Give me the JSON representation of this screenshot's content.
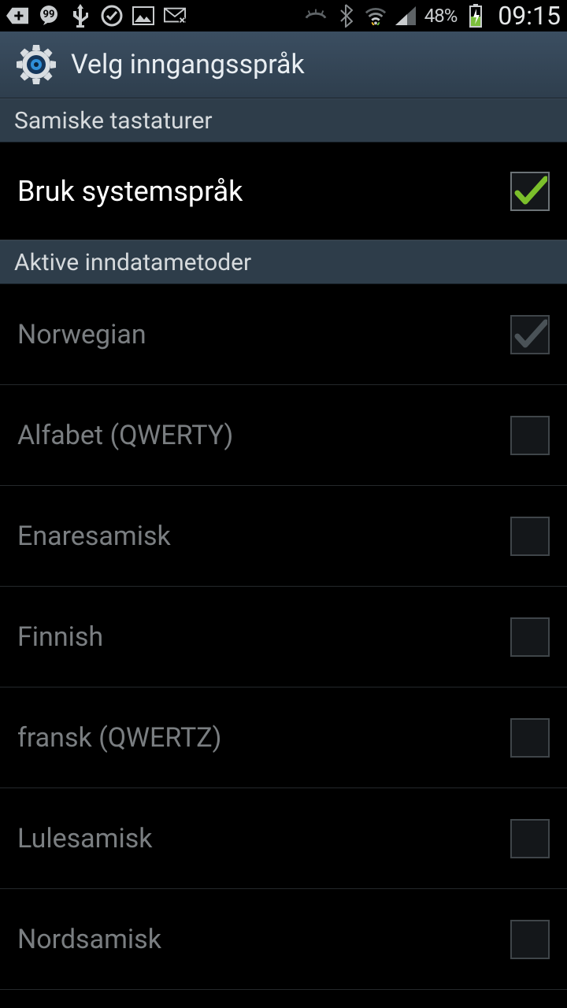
{
  "status": {
    "battery_pct": "48%",
    "clock": "09:15"
  },
  "title": "Velg inngangsspråk",
  "section_keyboards": "Samiske tastaturer",
  "system_lang": {
    "label": "Bruk systemspråk",
    "checked": true
  },
  "section_active": "Aktive inndatametoder",
  "inputs": [
    {
      "label": "Norwegian",
      "checked": true,
      "disabled": true
    },
    {
      "label": "Alfabet (QWERTY)",
      "checked": false,
      "disabled": true
    },
    {
      "label": "Enaresamisk",
      "checked": false,
      "disabled": true
    },
    {
      "label": "Finnish",
      "checked": false,
      "disabled": true
    },
    {
      "label": "fransk (QWERTZ)",
      "checked": false,
      "disabled": true
    },
    {
      "label": "Lulesamisk",
      "checked": false,
      "disabled": true
    },
    {
      "label": "Nordsamisk",
      "checked": false,
      "disabled": true
    }
  ]
}
